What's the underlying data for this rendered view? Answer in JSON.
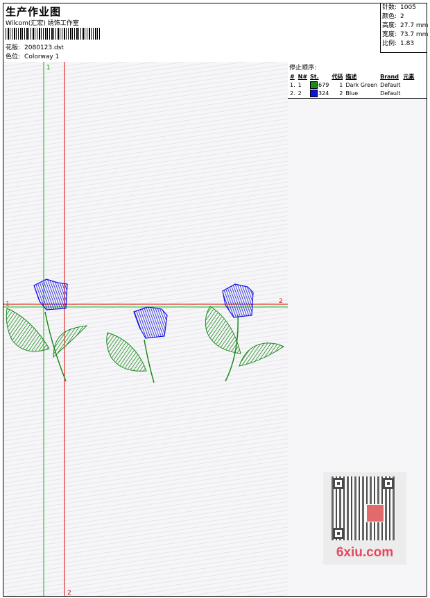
{
  "header": {
    "title": "生产作业图",
    "company": "Wilcom(汇宏) 绣饰工作室",
    "design_label": "花版:",
    "design_value": "2080123.dst",
    "colorway_label": "色位:",
    "colorway_value": "Colorway 1"
  },
  "stats": [
    {
      "label": "针数:",
      "value": "1005"
    },
    {
      "label": "颜色:",
      "value": "2"
    },
    {
      "label": "高度:",
      "value": "27.7 mm"
    },
    {
      "label": "宽度:",
      "value": "73.7 mm"
    },
    {
      "label": "比例:",
      "value": "1.83"
    }
  ],
  "stop_sequence": {
    "title": "停止顺序:",
    "columns": [
      "#",
      "N#",
      "St.",
      "代码",
      "描述",
      "Brand",
      "元素"
    ],
    "rows": [
      {
        "num": "1.",
        "n": "1",
        "stitches": "679",
        "code": "1",
        "desc": "Dark Green",
        "brand": "Default",
        "color": "#1a8a1a"
      },
      {
        "num": "2.",
        "n": "2",
        "stitches": "324",
        "code": "2",
        "desc": "Blue",
        "brand": "Default",
        "color": "#1010e0"
      }
    ]
  },
  "design_area": {
    "guide_labels": {
      "green_vertical": "1",
      "red_vertical": "2",
      "red_horizontal": "2",
      "green_horizontal": "1"
    },
    "colors": {
      "leaf": "#1a8a1a",
      "flower": "#1010e0",
      "guide_green": "#00c000",
      "guide_red": "#e00000"
    }
  },
  "watermark": {
    "text": "6xiu.com"
  }
}
